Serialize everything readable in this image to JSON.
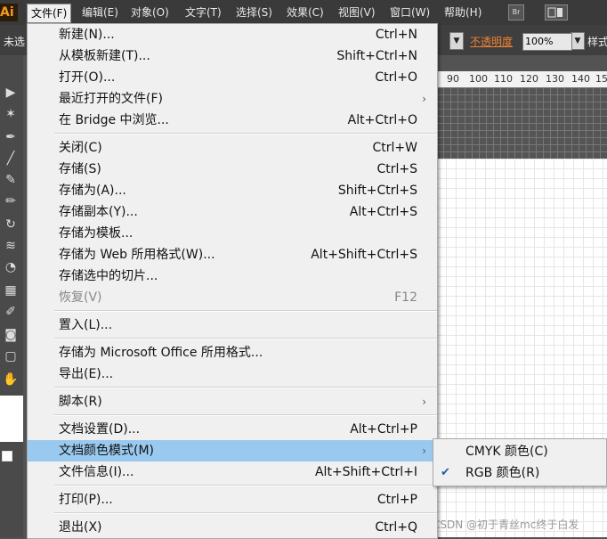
{
  "app": {
    "logo": "Ai"
  },
  "menubar": {
    "items": [
      "文件(F)",
      "编辑(E)",
      "对象(O)",
      "文字(T)",
      "选择(S)",
      "效果(C)",
      "视图(V)",
      "窗口(W)",
      "帮助(H)"
    ],
    "br_label": "Br"
  },
  "control_bar": {
    "selection_text": "未选",
    "opacity_label": "不透明度",
    "opacity_value": "100%",
    "style_label": "样式"
  },
  "ruler": {
    "ticks": [
      "90",
      "100",
      "110",
      "120",
      "130",
      "140",
      "15"
    ]
  },
  "file_menu": {
    "items": [
      {
        "label": "新建(N)...",
        "shortcut": "Ctrl+N"
      },
      {
        "label": "从模板新建(T)...",
        "shortcut": "Shift+Ctrl+N"
      },
      {
        "label": "打开(O)...",
        "shortcut": "Ctrl+O"
      },
      {
        "label": "最近打开的文件(F)",
        "shortcut": "",
        "submenu": true
      },
      {
        "label": "在 Bridge 中浏览...",
        "shortcut": "Alt+Ctrl+O"
      },
      {
        "label": "关闭(C)",
        "shortcut": "Ctrl+W"
      },
      {
        "label": "存储(S)",
        "shortcut": "Ctrl+S"
      },
      {
        "label": "存储为(A)...",
        "shortcut": "Shift+Ctrl+S"
      },
      {
        "label": "存储副本(Y)...",
        "shortcut": "Alt+Ctrl+S"
      },
      {
        "label": "存储为模板...",
        "shortcut": ""
      },
      {
        "label": "存储为 Web 所用格式(W)...",
        "shortcut": "Alt+Shift+Ctrl+S"
      },
      {
        "label": "存储选中的切片...",
        "shortcut": ""
      },
      {
        "label": "恢复(V)",
        "shortcut": "F12",
        "disabled": true
      },
      {
        "label": "置入(L)...",
        "shortcut": ""
      },
      {
        "label": "存储为 Microsoft Office 所用格式...",
        "shortcut": ""
      },
      {
        "label": "导出(E)...",
        "shortcut": ""
      },
      {
        "label": "脚本(R)",
        "shortcut": "",
        "submenu": true
      },
      {
        "label": "文档设置(D)...",
        "shortcut": "Alt+Ctrl+P"
      },
      {
        "label": "文档颜色模式(M)",
        "shortcut": "",
        "submenu": true,
        "highlighted": true
      },
      {
        "label": "文件信息(I)...",
        "shortcut": "Alt+Shift+Ctrl+I"
      },
      {
        "label": "打印(P)...",
        "shortcut": "Ctrl+P"
      },
      {
        "label": "退出(X)",
        "shortcut": "Ctrl+Q"
      }
    ]
  },
  "color_mode_submenu": {
    "items": [
      {
        "label": "CMYK 颜色(C)",
        "checked": false
      },
      {
        "label": "RGB 颜色(R)",
        "checked": true
      }
    ]
  },
  "watermark": "CSDN @初于青丝mc终于白发",
  "icons": {
    "selection": "selection-tool-icon",
    "magic_wand": "magic-wand-icon",
    "pen": "pen-tool-icon",
    "line": "line-tool-icon",
    "brush": "brush-tool-icon",
    "pencil": "pencil-tool-icon",
    "rotate": "rotate-tool-icon",
    "warp": "warp-tool-icon",
    "shape_builder": "shape-builder-icon",
    "mesh": "mesh-tool-icon",
    "eyedropper": "eyedropper-icon",
    "symbol_sprayer": "symbol-sprayer-icon",
    "artboard": "artboard-tool-icon",
    "hand": "hand-tool-icon"
  }
}
